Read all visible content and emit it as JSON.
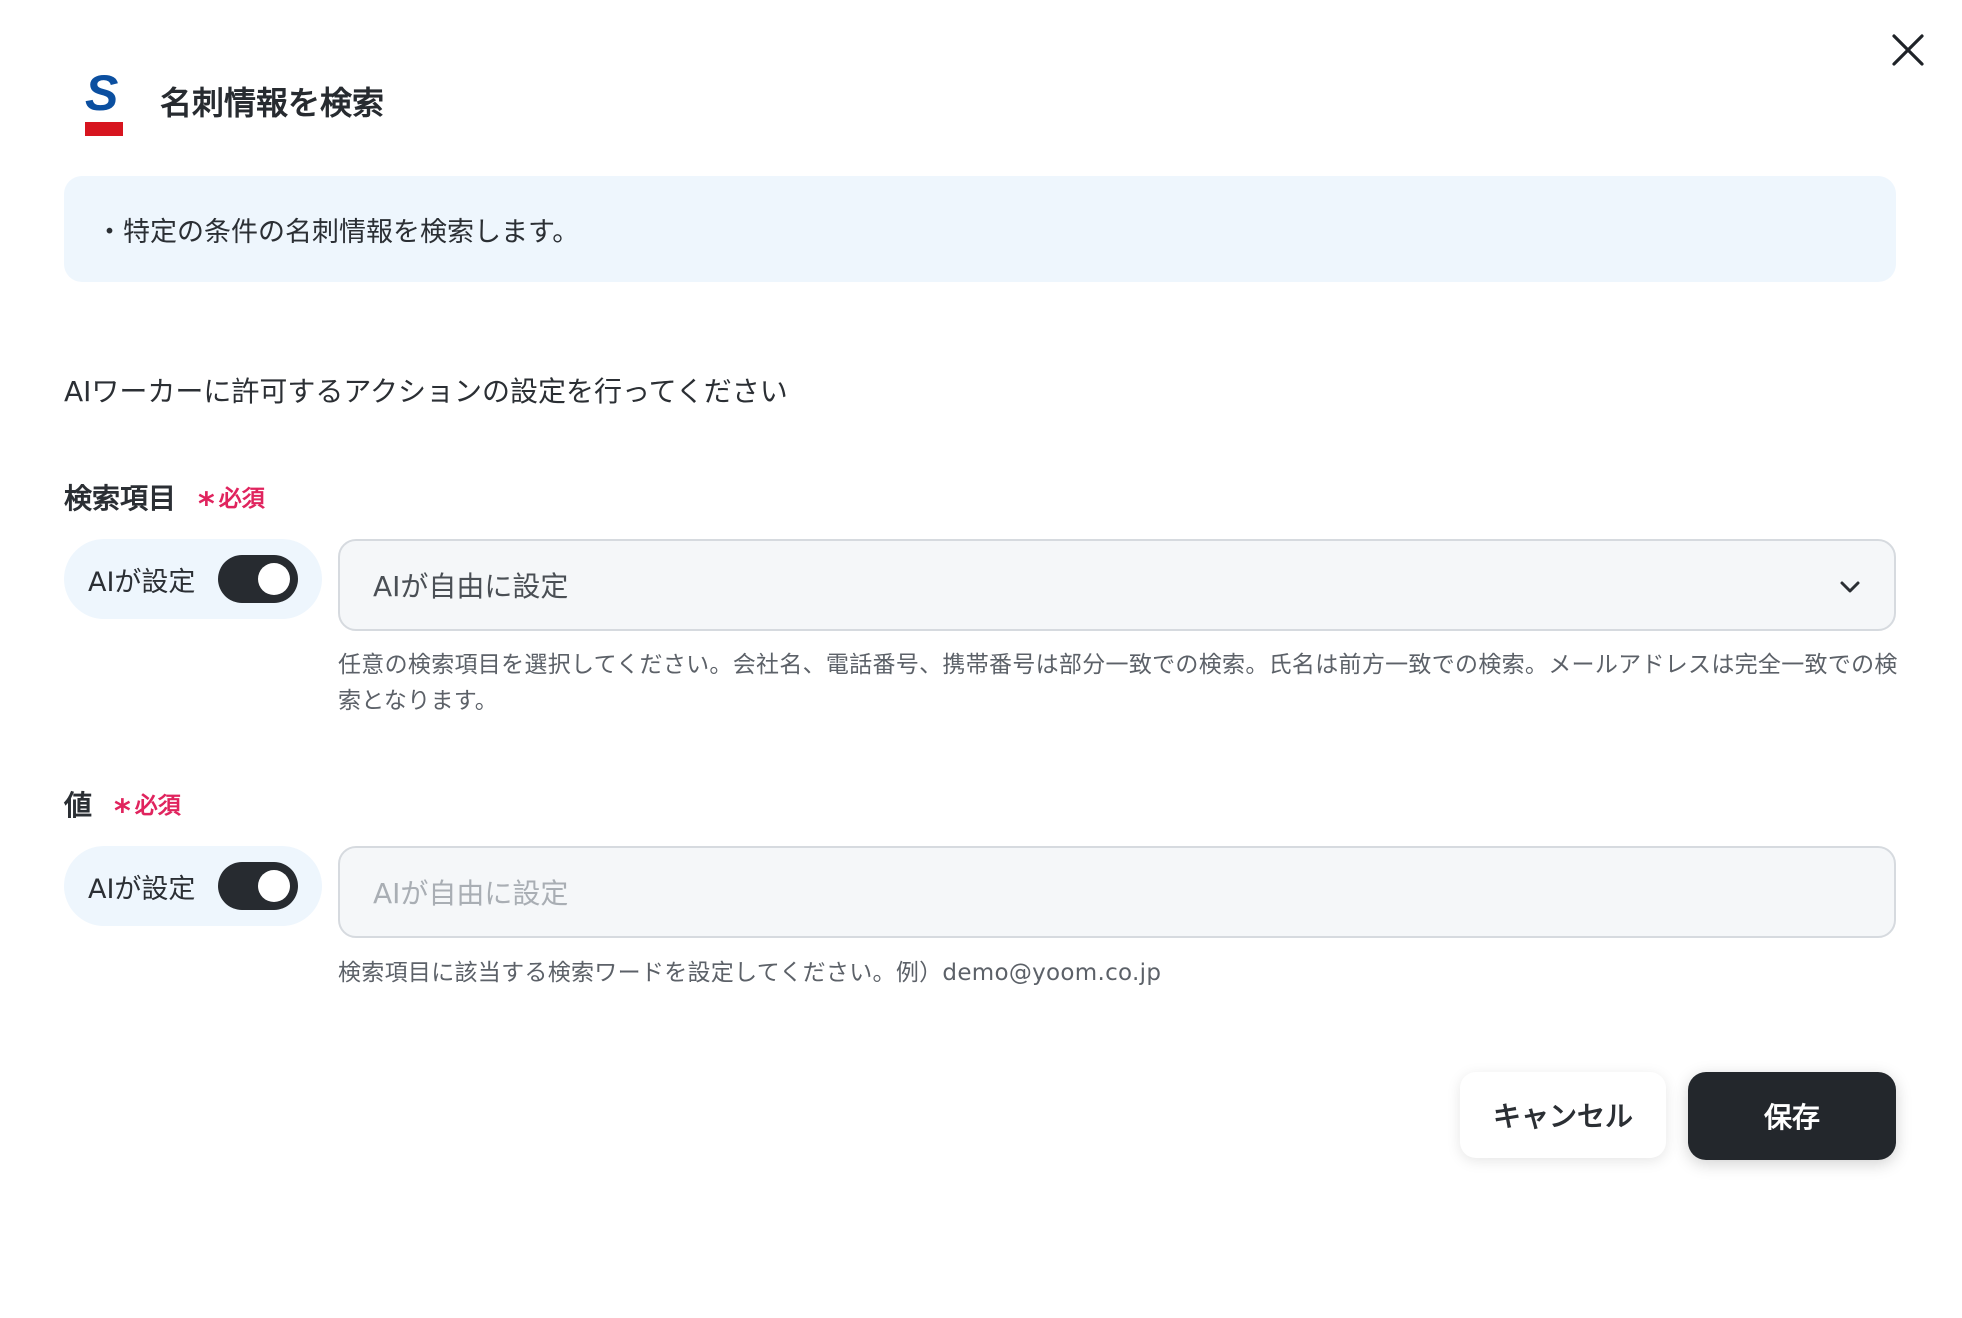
{
  "header": {
    "title": "名刺情報を検索",
    "logo_icon": "sansan-logo-icon",
    "logo_colors": {
      "letter": "#0b4fa0",
      "bar": "#d7151f"
    },
    "close_icon": "close-icon"
  },
  "info": {
    "text": "・特定の条件の名刺情報を検索します。"
  },
  "intro": "AIワーカーに許可するアクションの設定を行ってください",
  "fields": [
    {
      "label": "検索項目",
      "required_mark": "*",
      "required_text": "必須",
      "ai_toggle_label": "AIが設定",
      "ai_toggle_on": true,
      "value": "AIが自由に設定",
      "control": "select",
      "help": "任意の検索項目を選択してください。会社名、電話番号、携帯番号は部分一致での検索。氏名は前方一致での検索。メールアドレスは完全一致での検索となります。"
    },
    {
      "label": "値",
      "required_mark": "*",
      "required_text": "必須",
      "ai_toggle_label": "AIが設定",
      "ai_toggle_on": true,
      "placeholder": "AIが自由に設定",
      "control": "text",
      "help": "検索項目に該当する検索ワードを設定してください。例）demo@yoom.co.jp"
    }
  ],
  "footer": {
    "cancel_label": "キャンセル",
    "save_label": "保存"
  },
  "colors": {
    "accent_dark": "#23272c",
    "required": "#e0245e",
    "info_bg": "#eef6fd"
  }
}
